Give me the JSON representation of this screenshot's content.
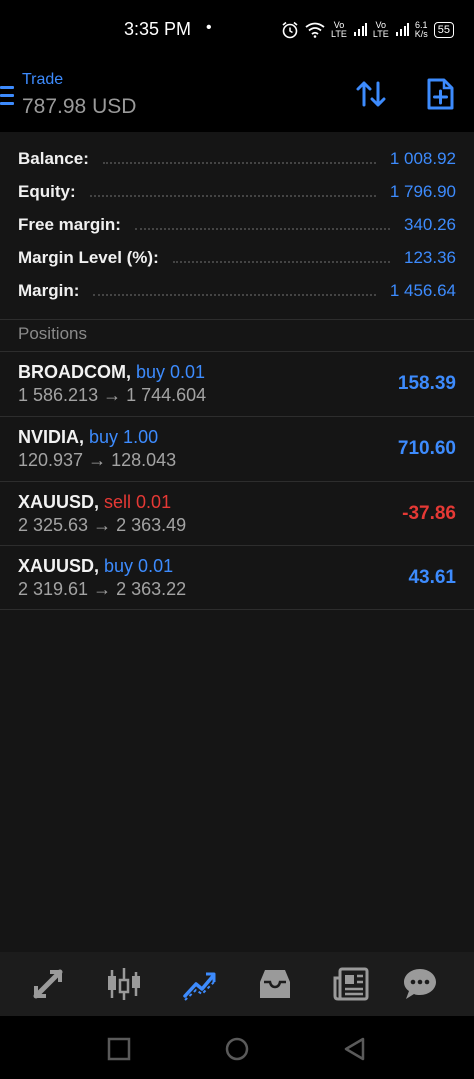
{
  "status_bar": {
    "time": "3:35 PM",
    "dot": "•",
    "net1_top": "Vo",
    "net1_bottom": "LTE",
    "net2_top": "Vo",
    "net2_bottom": "LTE",
    "speed_top": "6.1",
    "speed_bottom": "K/s",
    "battery": "55"
  },
  "header": {
    "title": "Trade",
    "subtitle": "787.98 USD",
    "icons": [
      "menu-icon",
      "sort-icon",
      "new-order-icon"
    ]
  },
  "summary": [
    {
      "label": "Balance:",
      "value": "1 008.92"
    },
    {
      "label": "Equity:",
      "value": "1 796.90"
    },
    {
      "label": "Free margin:",
      "value": "340.26"
    },
    {
      "label": "Margin Level (%):",
      "value": "123.36"
    },
    {
      "label": "Margin:",
      "value": "1 456.64"
    }
  ],
  "positions": {
    "heading": "Positions",
    "items": [
      {
        "symbol": "BROADCOM,",
        "type": "buy 0.01",
        "side": "buy",
        "prices": "1 586.213 → 1 744.604",
        "profit": "158.39"
      },
      {
        "symbol": "NVIDIA,",
        "type": "buy 1.00",
        "side": "buy",
        "prices": "120.937 → 128.043",
        "profit": "710.60"
      },
      {
        "symbol": "XAUUSD,",
        "type": "sell 0.01",
        "side": "sell",
        "prices": "2 325.63 → 2 363.49",
        "profit": "-37.86"
      },
      {
        "symbol": "XAUUSD,",
        "type": "buy 0.01",
        "side": "buy",
        "prices": "2 319.61 → 2 363.22",
        "profit": "43.61"
      }
    ]
  },
  "tabs": [
    {
      "name": "quotes-tab",
      "icon": "arrows-diagonal-icon",
      "active": false
    },
    {
      "name": "chart-tab",
      "icon": "candlestick-icon",
      "active": false
    },
    {
      "name": "trade-tab",
      "icon": "trend-line-icon",
      "active": true
    },
    {
      "name": "history-tab",
      "icon": "inbox-icon",
      "active": false
    },
    {
      "name": "news-tab",
      "icon": "newspaper-icon",
      "active": false
    },
    {
      "name": "messages-tab",
      "icon": "chat-bubble-icon",
      "active": false
    }
  ],
  "colors": {
    "accent": "#3d8bfd",
    "loss": "#e53935",
    "background": "#151515"
  }
}
